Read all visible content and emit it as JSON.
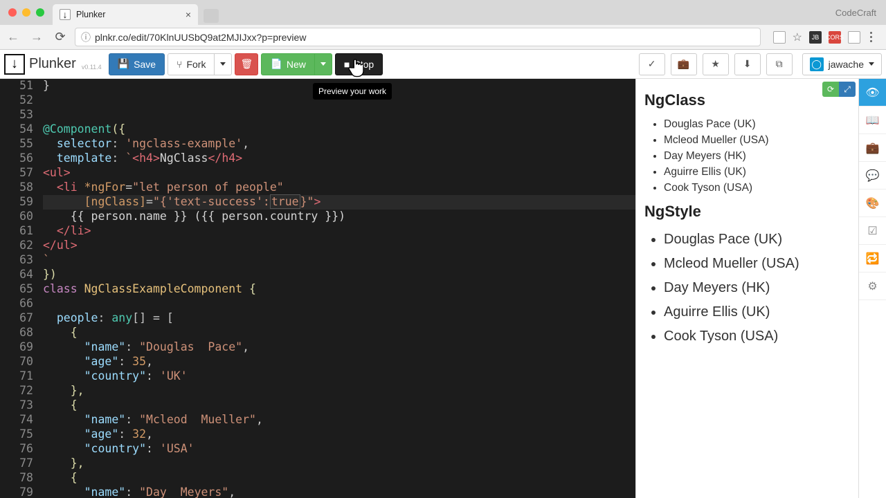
{
  "browser": {
    "tab_title": "Plunker",
    "url": "plnkr.co/edit/70KlnUUSbQ9at2MJIJxx?p=preview",
    "watermark": "CodeCraft"
  },
  "toolbar": {
    "brand": "Plunker",
    "version": "v0.11.4",
    "save": "Save",
    "fork": "Fork",
    "new": "New",
    "stop": "Stop",
    "tooltip": "Preview your work",
    "user": "jawache"
  },
  "preview": {
    "h1": "NgClass",
    "list1": [
      "Douglas Pace (UK)",
      "Mcleod Mueller (USA)",
      "Day Meyers (HK)",
      "Aguirre Ellis (UK)",
      "Cook Tyson (USA)"
    ],
    "h2": "NgStyle",
    "list2": [
      "Douglas Pace (UK)",
      "Mcleod Mueller (USA)",
      "Day Meyers (HK)",
      "Aguirre Ellis (UK)",
      "Cook Tyson (USA)"
    ]
  },
  "editor": {
    "first_line": 51,
    "active_line": 59,
    "lines": [
      {
        "n": 51,
        "seg": [
          {
            "t": "}",
            "c": "punct"
          }
        ]
      },
      {
        "n": 52,
        "seg": []
      },
      {
        "n": 53,
        "seg": []
      },
      {
        "n": 54,
        "seg": [
          {
            "t": "@Component",
            "c": "type"
          },
          {
            "t": "({",
            "c": "brace"
          }
        ]
      },
      {
        "n": 55,
        "seg": [
          {
            "t": "  selector",
            "c": "key"
          },
          {
            "t": ": ",
            "c": "punct"
          },
          {
            "t": "'ngclass-example'",
            "c": "string"
          },
          {
            "t": ",",
            "c": "punct"
          }
        ]
      },
      {
        "n": 56,
        "seg": [
          {
            "t": "  template",
            "c": "key"
          },
          {
            "t": ": ",
            "c": "punct"
          },
          {
            "t": "`",
            "c": "string"
          },
          {
            "t": "<h4>",
            "c": "tag"
          },
          {
            "t": "NgClass",
            "c": "templ"
          },
          {
            "t": "</h4>",
            "c": "tag"
          }
        ]
      },
      {
        "n": 57,
        "seg": [
          {
            "t": "<ul>",
            "c": "tag"
          }
        ]
      },
      {
        "n": 58,
        "seg": [
          {
            "t": "  <li ",
            "c": "tag"
          },
          {
            "t": "*ngFor",
            "c": "attr"
          },
          {
            "t": "=",
            "c": "punct"
          },
          {
            "t": "\"let person of people\"",
            "c": "string"
          }
        ]
      },
      {
        "n": 59,
        "seg": [
          {
            "t": "      [ngClass]",
            "c": "attr"
          },
          {
            "t": "=",
            "c": "punct"
          },
          {
            "t": "\"{'text-success':",
            "c": "string"
          },
          {
            "t": "true",
            "c": "hilite"
          },
          {
            "t": "}\"",
            "c": "string"
          },
          {
            "t": ">",
            "c": "tag"
          }
        ]
      },
      {
        "n": 60,
        "seg": [
          {
            "t": "    {{ person.name }} ({{ person.country }})",
            "c": "templ"
          }
        ]
      },
      {
        "n": 61,
        "seg": [
          {
            "t": "  </li>",
            "c": "tag"
          }
        ]
      },
      {
        "n": 62,
        "seg": [
          {
            "t": "</ul>",
            "c": "tag"
          }
        ]
      },
      {
        "n": 63,
        "seg": [
          {
            "t": "`",
            "c": "string"
          }
        ]
      },
      {
        "n": 64,
        "seg": [
          {
            "t": "})",
            "c": "brace"
          }
        ]
      },
      {
        "n": 65,
        "seg": [
          {
            "t": "class ",
            "c": "keyword"
          },
          {
            "t": "NgClassExampleComponent ",
            "c": "class"
          },
          {
            "t": "{",
            "c": "brace"
          }
        ]
      },
      {
        "n": 66,
        "seg": []
      },
      {
        "n": 67,
        "seg": [
          {
            "t": "  people",
            "c": "key"
          },
          {
            "t": ": ",
            "c": "punct"
          },
          {
            "t": "any",
            "c": "type"
          },
          {
            "t": "[] = [",
            "c": "punct"
          }
        ]
      },
      {
        "n": 68,
        "seg": [
          {
            "t": "    {",
            "c": "brace"
          }
        ]
      },
      {
        "n": 69,
        "seg": [
          {
            "t": "      \"name\"",
            "c": "key"
          },
          {
            "t": ": ",
            "c": "punct"
          },
          {
            "t": "\"Douglas  Pace\"",
            "c": "string"
          },
          {
            "t": ",",
            "c": "punct"
          }
        ]
      },
      {
        "n": 70,
        "seg": [
          {
            "t": "      \"age\"",
            "c": "key"
          },
          {
            "t": ": ",
            "c": "punct"
          },
          {
            "t": "35",
            "c": "num"
          },
          {
            "t": ",",
            "c": "punct"
          }
        ]
      },
      {
        "n": 71,
        "seg": [
          {
            "t": "      \"country\"",
            "c": "key"
          },
          {
            "t": ": ",
            "c": "punct"
          },
          {
            "t": "'UK'",
            "c": "string"
          }
        ]
      },
      {
        "n": 72,
        "seg": [
          {
            "t": "    },",
            "c": "brace"
          }
        ]
      },
      {
        "n": 73,
        "seg": [
          {
            "t": "    {",
            "c": "brace"
          }
        ]
      },
      {
        "n": 74,
        "seg": [
          {
            "t": "      \"name\"",
            "c": "key"
          },
          {
            "t": ": ",
            "c": "punct"
          },
          {
            "t": "\"Mcleod  Mueller\"",
            "c": "string"
          },
          {
            "t": ",",
            "c": "punct"
          }
        ]
      },
      {
        "n": 75,
        "seg": [
          {
            "t": "      \"age\"",
            "c": "key"
          },
          {
            "t": ": ",
            "c": "punct"
          },
          {
            "t": "32",
            "c": "num"
          },
          {
            "t": ",",
            "c": "punct"
          }
        ]
      },
      {
        "n": 76,
        "seg": [
          {
            "t": "      \"country\"",
            "c": "key"
          },
          {
            "t": ": ",
            "c": "punct"
          },
          {
            "t": "'USA'",
            "c": "string"
          }
        ]
      },
      {
        "n": 77,
        "seg": [
          {
            "t": "    },",
            "c": "brace"
          }
        ]
      },
      {
        "n": 78,
        "seg": [
          {
            "t": "    {",
            "c": "brace"
          }
        ]
      },
      {
        "n": 79,
        "seg": [
          {
            "t": "      \"name\"",
            "c": "key"
          },
          {
            "t": ": ",
            "c": "punct"
          },
          {
            "t": "\"Day  Meyers\"",
            "c": "string"
          },
          {
            "t": ",",
            "c": "punct"
          }
        ]
      }
    ]
  }
}
